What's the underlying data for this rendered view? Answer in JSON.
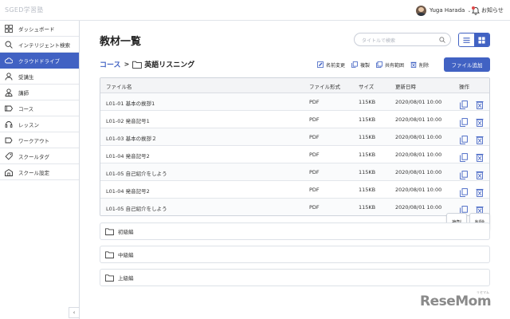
{
  "app": {
    "brand": "SGED学習塾"
  },
  "header": {
    "username": "Yuga Harada",
    "notice_label": "お知らせ"
  },
  "sidebar": {
    "items": [
      {
        "label": "ダッシュボード",
        "icon": "dashboard-icon"
      },
      {
        "label": "インテリジェント検索",
        "icon": "search-icon"
      },
      {
        "label": "クラウドドライブ",
        "icon": "cloud-icon",
        "active": true
      },
      {
        "label": "受講生",
        "icon": "student-icon"
      },
      {
        "label": "講師",
        "icon": "teacher-icon"
      },
      {
        "label": "コース",
        "icon": "course-icon"
      },
      {
        "label": "レッスン",
        "icon": "headset-icon"
      },
      {
        "label": "ワークアウト",
        "icon": "workout-icon"
      },
      {
        "label": "スクールタグ",
        "icon": "tag-icon"
      },
      {
        "label": "スクール設定",
        "icon": "school-icon"
      }
    ],
    "collapse_glyph": "‹"
  },
  "main": {
    "title": "教材一覧",
    "search_placeholder": "タイトルで検索",
    "breadcrumb": {
      "root": "コース",
      "separator": ">",
      "current": "英語リスニング"
    },
    "actions": [
      "名前変更",
      "複製",
      "共有範囲",
      "削除"
    ],
    "add_file_label": "ファイル追加",
    "table": {
      "headers": [
        "ファイル名",
        "ファイル形式",
        "サイズ",
        "更新日時",
        "操作"
      ],
      "rows": [
        {
          "name": "L01-01 基本の挨拶1",
          "format": "PDF",
          "size": "115KB",
          "updated": "2020/08/01 10:00"
        },
        {
          "name": "L01-02 発音記号1",
          "format": "PDF",
          "size": "115KB",
          "updated": "2020/08/01 10:00"
        },
        {
          "name": "L01-03 基本の挨拶２",
          "format": "PDF",
          "size": "115KB",
          "updated": "2020/08/01 10:00"
        },
        {
          "name": "L01-04 発音記号2",
          "format": "PDF",
          "size": "115KB",
          "updated": "2020/08/01 10:00"
        },
        {
          "name": "L01-05 自己紹介をしよう",
          "format": "PDF",
          "size": "115KB",
          "updated": "2020/08/01 10:00"
        },
        {
          "name": "L01-04 発音記号2",
          "format": "PDF",
          "size": "115KB",
          "updated": "2020/08/01 10:00"
        },
        {
          "name": "L01-05 自己紹介をしよう",
          "format": "PDF",
          "size": "115KB",
          "updated": "2020/08/01 10:00"
        }
      ]
    },
    "row_actions": {
      "copy_label": "複製",
      "delete_label": "削除"
    },
    "folders": [
      "初級編",
      "中級編",
      "上級編"
    ]
  },
  "colors": {
    "accent": "#4162c3",
    "danger": "#e04848"
  },
  "watermark": {
    "text": "ReseMom",
    "small": "リセマム"
  }
}
